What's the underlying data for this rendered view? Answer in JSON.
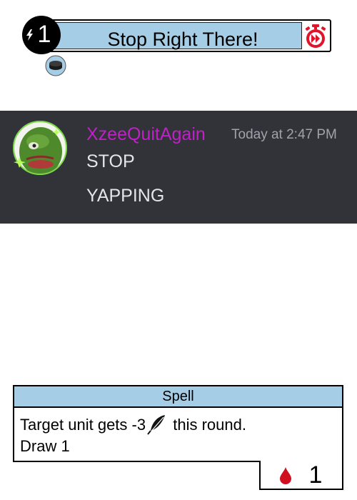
{
  "card_top": {
    "energy_cost": "1",
    "title": "Stop Right There!",
    "icons": {
      "energy": "lightning-bolt-icon",
      "timer": "stopwatch-fast-forward-icon",
      "token": "puck-token-icon"
    }
  },
  "chat": {
    "username": "XzeeQuitAgain",
    "timestamp": "Today at 2:47 PM",
    "messages": [
      "STOP",
      "YAPPING"
    ],
    "colors": {
      "background": "#313338",
      "username": "#c020c8",
      "text": "#e3e5e8",
      "timestamp": "#a0a3ab"
    }
  },
  "card_bottom": {
    "type": "Spell",
    "text_part1": "Target unit gets -3",
    "text_part2": " this round.",
    "text_line2": "Draw 1",
    "stat_icon": "feather-icon",
    "cost_icon": "blood-drop-icon",
    "cost_value": "1"
  },
  "colors": {
    "banner": "#a6cde6",
    "blood": "#d0101e",
    "timer": "#e0142a"
  }
}
